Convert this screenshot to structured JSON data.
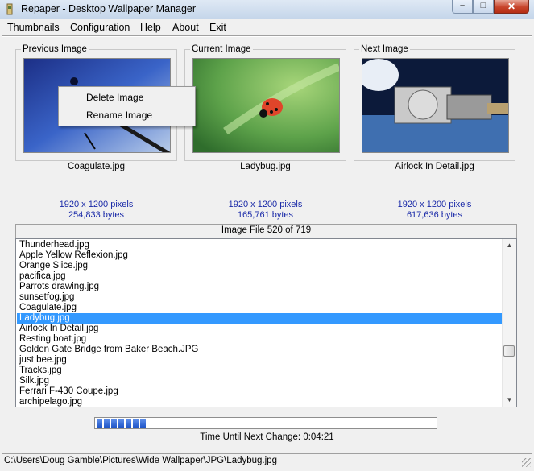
{
  "window": {
    "title": "Repaper - Desktop Wallpaper Manager",
    "icon": "app-icon"
  },
  "menu": [
    "Thumbnails",
    "Configuration",
    "Help",
    "About",
    "Exit"
  ],
  "panels": [
    {
      "label": "Previous Image",
      "filename": "Coagulate.jpg",
      "dimensions": "1920 x 1200 pixels",
      "size": "254,833 bytes"
    },
    {
      "label": "Current Image",
      "filename": "Ladybug.jpg",
      "dimensions": "1920 x 1200 pixels",
      "size": "165,761 bytes"
    },
    {
      "label": "Next Image",
      "filename": "Airlock In Detail.jpg",
      "dimensions": "1920 x 1200 pixels",
      "size": "617,636 bytes"
    }
  ],
  "context_menu": [
    "Delete Image",
    "Rename Image"
  ],
  "counter": "Image File 520 of 719",
  "files": [
    "Thunderhead.jpg",
    "Apple Yellow Reflexion.jpg",
    "Orange Slice.jpg",
    "pacifica.jpg",
    "Parrots drawing.jpg",
    "sunsetfog.jpg",
    "Coagulate.jpg",
    "Ladybug.jpg",
    "Airlock In Detail.jpg",
    "Resting boat.jpg",
    "Golden Gate Bridge from Baker Beach.JPG",
    "just bee.jpg",
    "Tracks.jpg",
    "Silk.jpg",
    "Ferrari F-430 Coupe.jpg",
    "archipelago.jpg"
  ],
  "selected_file": "Ladybug.jpg",
  "countdown": {
    "progress": 0.15,
    "label": "Time Until Next Change: 0:04:21"
  },
  "status_path": "C:\\Users\\Doug Gamble\\Pictures\\Wide Wallpaper\\JPG\\Ladybug.jpg",
  "colors": {
    "selection": "#3399ff",
    "info_text": "#1a2aa8",
    "progress": "#1f55c8"
  }
}
